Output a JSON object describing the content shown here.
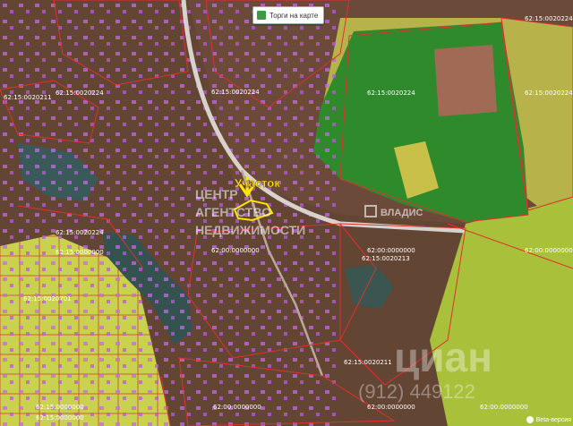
{
  "toolbar": {
    "map_button_label": "Торги на карте",
    "map_button_icon": "map-grid-icon"
  },
  "marker": {
    "label": "Участок",
    "color": "#ffe600"
  },
  "watermarks": {
    "agency_line1": "ЦЕНТР",
    "agency_line2": "АГЕНТСТВО",
    "agency_line3": "НЕДВИЖИМОСТИ",
    "vladis": "ВЛАДИС",
    "cian": "циан",
    "phone_partial": "(912) 449122"
  },
  "parcel_labels": [
    "62:15:0020211",
    "62:15:0020224",
    "62:15:0020224",
    "62:15:0020224",
    "62:15:0020224",
    "62:15:0020224",
    "62:15:0020224",
    "62:15:0000000",
    "62:00:0000000",
    "62:00:0000000",
    "62:15:0020213",
    "62:00:0000000",
    "62:15:0020701",
    "62:15:0020211",
    "62:15:0000000",
    "62:15:0000000",
    "62:00:0000000",
    "62:00:0000000",
    "62:00:0000000"
  ],
  "footer": {
    "beta_label": "Beta-версия",
    "beta_icon": "info-circle-icon"
  },
  "colors": {
    "parcel_outline": "#e03030",
    "forest": "#2e8b2e",
    "field": "#b5c83c",
    "garden_plots": "#d9e34a",
    "buildings": "#c060e0"
  }
}
